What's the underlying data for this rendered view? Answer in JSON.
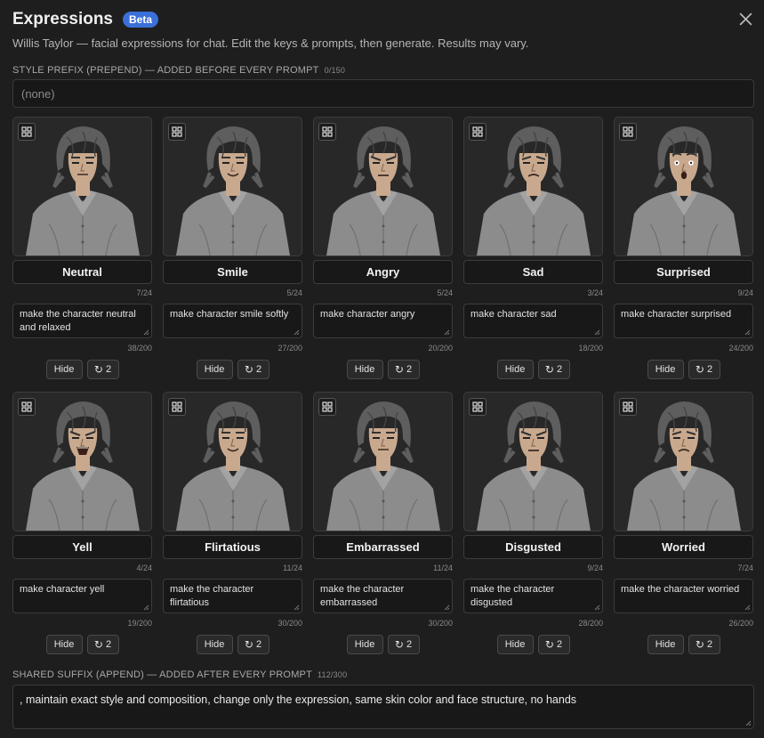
{
  "header": {
    "title": "Expressions",
    "badge": "Beta",
    "subtitle": "Willis Taylor — facial expressions for chat. Edit the keys & prompts, then generate. Results may vary."
  },
  "prefix": {
    "label": "STYLE PREFIX (PREPEND) — ADDED BEFORE EVERY PROMPT",
    "count": "0/150",
    "placeholder": "(none)",
    "value": ""
  },
  "buttons": {
    "hide_label": "Hide",
    "regen_count": "2"
  },
  "expressions": [
    {
      "name": "Neutral",
      "name_count": "7/24",
      "prompt": "make the character neutral and relaxed",
      "prompt_count": "38/200",
      "mood": "neutral"
    },
    {
      "name": "Smile",
      "name_count": "5/24",
      "prompt": "make character smile softly",
      "prompt_count": "27/200",
      "mood": "smile"
    },
    {
      "name": "Angry",
      "name_count": "5/24",
      "prompt": "make character angry",
      "prompt_count": "20/200",
      "mood": "angry"
    },
    {
      "name": "Sad",
      "name_count": "3/24",
      "prompt": "make character sad",
      "prompt_count": "18/200",
      "mood": "sad"
    },
    {
      "name": "Surprised",
      "name_count": "9/24",
      "prompt": "make character surprised",
      "prompt_count": "24/200",
      "mood": "surprised"
    },
    {
      "name": "Yell",
      "name_count": "4/24",
      "prompt": "make character yell",
      "prompt_count": "19/200",
      "mood": "yell"
    },
    {
      "name": "Flirtatious",
      "name_count": "11/24",
      "prompt": "make the character flirtatious",
      "prompt_count": "30/200",
      "mood": "smile"
    },
    {
      "name": "Embarrassed",
      "name_count": "11/24",
      "prompt": "make the character embarrassed",
      "prompt_count": "30/200",
      "mood": "neutral"
    },
    {
      "name": "Disgusted",
      "name_count": "9/24",
      "prompt": "make the character disgusted",
      "prompt_count": "28/200",
      "mood": "angry"
    },
    {
      "name": "Worried",
      "name_count": "7/24",
      "prompt": "make the character worried",
      "prompt_count": "26/200",
      "mood": "sad"
    }
  ],
  "suffix": {
    "label": "SHARED SUFFIX (APPEND) — ADDED AFTER EVERY PROMPT",
    "count": "112/300",
    "value": ", maintain exact style and composition, change only the expression, same skin color and face structure, no hands"
  },
  "colors": {
    "background": "#1e1e1e",
    "accent": "#3b6fd9",
    "shirt": "#8c8c8c",
    "skin": "#c9a98e",
    "hair": "#5e5e5e"
  }
}
